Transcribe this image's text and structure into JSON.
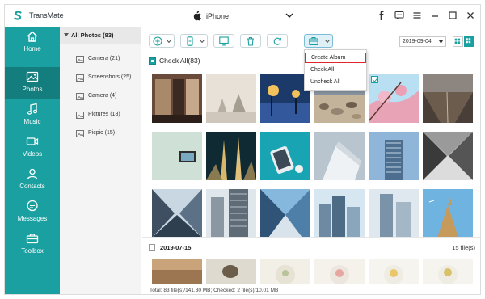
{
  "app": {
    "title": "TransMate"
  },
  "device": {
    "name": "iPhone"
  },
  "window_controls": [
    "facebook-icon",
    "feedback-icon",
    "menu-icon",
    "minimize-icon",
    "maximize-icon",
    "close-icon"
  ],
  "nav": {
    "items": [
      {
        "label": "Home",
        "icon": "home-icon",
        "active": false
      },
      {
        "label": "Photos",
        "icon": "photos-icon",
        "active": true
      },
      {
        "label": "Music",
        "icon": "music-icon",
        "active": false
      },
      {
        "label": "Videos",
        "icon": "videos-icon",
        "active": false
      },
      {
        "label": "Contacts",
        "icon": "contacts-icon",
        "active": false
      },
      {
        "label": "Messages",
        "icon": "messages-icon",
        "active": false
      },
      {
        "label": "Toolbox",
        "icon": "toolbox-icon",
        "active": false
      }
    ]
  },
  "albums": {
    "header": "All Photos (83)",
    "items": [
      {
        "label": "Camera (21)"
      },
      {
        "label": "Screenshots (25)"
      },
      {
        "label": "Camera (4)"
      },
      {
        "label": "Pictures (18)"
      },
      {
        "label": "Picpic (15)"
      }
    ]
  },
  "toolbar": {
    "buttons": [
      "add-icon",
      "export-to-device-icon",
      "export-to-pc-icon",
      "delete-icon",
      "refresh-icon",
      "album-toolbox-icon"
    ],
    "date_value": "2019-09-04",
    "view_modes": [
      "grid-small-view",
      "grid-large-view"
    ]
  },
  "content": {
    "check_all_label": "Check All(83)",
    "sections": [
      {
        "date": "",
        "count": ""
      },
      {
        "date": "2019-07-15",
        "count": "15 file(s)"
      }
    ]
  },
  "menu": {
    "items": [
      {
        "label": "Create Album",
        "highlighted": true
      },
      {
        "label": "Check All",
        "highlighted": false
      },
      {
        "label": "Uncheck All",
        "highlighted": false
      }
    ]
  },
  "status": {
    "text": "Total: 83 file(s)/141.30 MB; Checked: 2 file(s)/10.01 MB"
  },
  "colors": {
    "brand": "#1aa0a0",
    "nav_active": "#147d7e",
    "menu_highlight": "#e0262b"
  }
}
